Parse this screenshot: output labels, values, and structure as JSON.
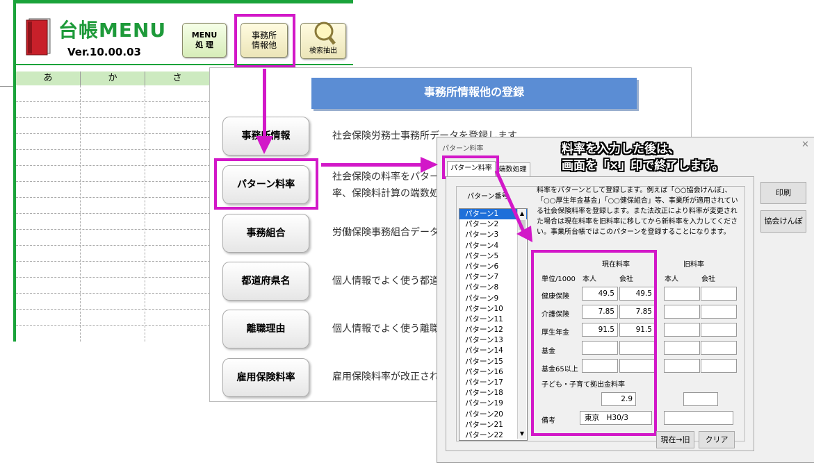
{
  "menu": {
    "title": "台帳MENU",
    "version": "Ver.10.00.03",
    "buttons": {
      "menu_process": "MENU\n処 理",
      "office_info": "事務所\n情報他",
      "search_extract": "検索抽出"
    },
    "columns": [
      "あ",
      "か",
      "さ"
    ]
  },
  "registration": {
    "title": "事務所情報他の登録",
    "items": [
      {
        "label": "事務所情報",
        "desc": "社会保険労務士事務所データを登録します"
      },
      {
        "label": "パターン料率",
        "desc": "社会保険の料率をパター",
        "desc2": "率、保険料計算の端数処"
      },
      {
        "label": "事務組合",
        "desc": "労働保険事務組合データ"
      },
      {
        "label": "都道府県名",
        "desc": "個人情報でよく使う都道"
      },
      {
        "label": "離職理由",
        "desc": "個人情報でよく使う離職"
      },
      {
        "label": "雇用保険料率",
        "desc": "雇用保険料率が改正され"
      }
    ]
  },
  "dialog": {
    "title": "パターン料率",
    "tabs": [
      "パターン料率",
      "端数処理"
    ],
    "pattern_label": "パターン番号",
    "patterns": [
      "パターン1",
      "パターン2",
      "パターン3",
      "パターン4",
      "パターン5",
      "パターン6",
      "パターン7",
      "パターン8",
      "パターン9",
      "パターン10",
      "パターン11",
      "パターン12",
      "パターン13",
      "パターン14",
      "パターン15",
      "パターン16",
      "パターン17",
      "パターン18",
      "パターン19",
      "パターン20",
      "パターン21",
      "パターン22"
    ],
    "selected_pattern": "パターン1",
    "info": "料率をパターンとして登録します。例えば「○○協会けんぽ」、「○○厚生年金基金」「○○健保組合」等、事業所が適用されている社会保険料率を登録します。また法改正により料率が変更された場合は現在料率を旧料率に移してから新料率を入力してください。事業所台帳ではこのパターンを登録することになります。",
    "current_rate_label": "現在料率",
    "old_rate_label": "旧料率",
    "unit_label": "単位/1000",
    "person_label": "本人",
    "company_label": "会社",
    "rows": [
      {
        "label": "健康保険",
        "cur_person": "49.5",
        "cur_company": "49.5",
        "old_person": "",
        "old_company": ""
      },
      {
        "label": "介護保険",
        "cur_person": "7.85",
        "cur_company": "7.85",
        "old_person": "",
        "old_company": ""
      },
      {
        "label": "厚生年金",
        "cur_person": "91.5",
        "cur_company": "91.5",
        "old_person": "",
        "old_company": ""
      },
      {
        "label": "基金",
        "cur_person": "",
        "cur_company": "",
        "old_person": "",
        "old_company": ""
      },
      {
        "label": "基金65以上",
        "cur_person": "",
        "cur_company": "",
        "old_person": "",
        "old_company": ""
      }
    ],
    "child_label": "子ども・子育て拠出金料率",
    "child_current": "2.9",
    "child_old": "",
    "notes_label": "備考",
    "notes_current": "東京　H30/3",
    "notes_old": "",
    "buttons": {
      "print": "印刷",
      "kyokai": "協会けんぽ",
      "move": "現在→旧",
      "clear": "クリア"
    }
  },
  "annotation": {
    "line1": "料率を入力した後は、",
    "line2": "画面を「×」印で終了します。"
  },
  "colors": {
    "brand_green": "#1aa33a",
    "highlight": "#d218c8",
    "title_blue": "#5b8dd4",
    "selection_blue": "#1e6fd9"
  }
}
